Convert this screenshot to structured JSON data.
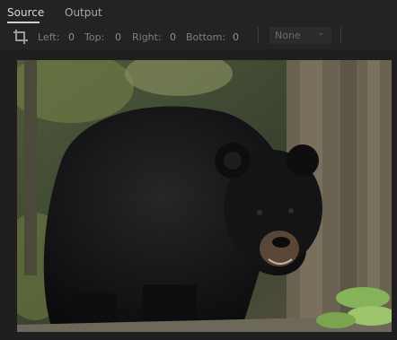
{
  "tabs": [
    {
      "label": "Source",
      "active": true
    },
    {
      "label": "Output",
      "active": false
    }
  ],
  "toolbar": {
    "crop_icon": "crop-icon",
    "left_label": "Left:",
    "left_value": "0",
    "top_label": "Top:",
    "top_value": "0",
    "right_label": "Right:",
    "right_value": "0",
    "bottom_label": "Bottom:",
    "bottom_value": "0",
    "aspect_select": "None"
  },
  "preview": {
    "image_subject": "black bear in forest"
  },
  "colors": {
    "background": "#232323",
    "tab_active": "#d8d8d8",
    "tab_inactive": "#a8a8a8"
  }
}
